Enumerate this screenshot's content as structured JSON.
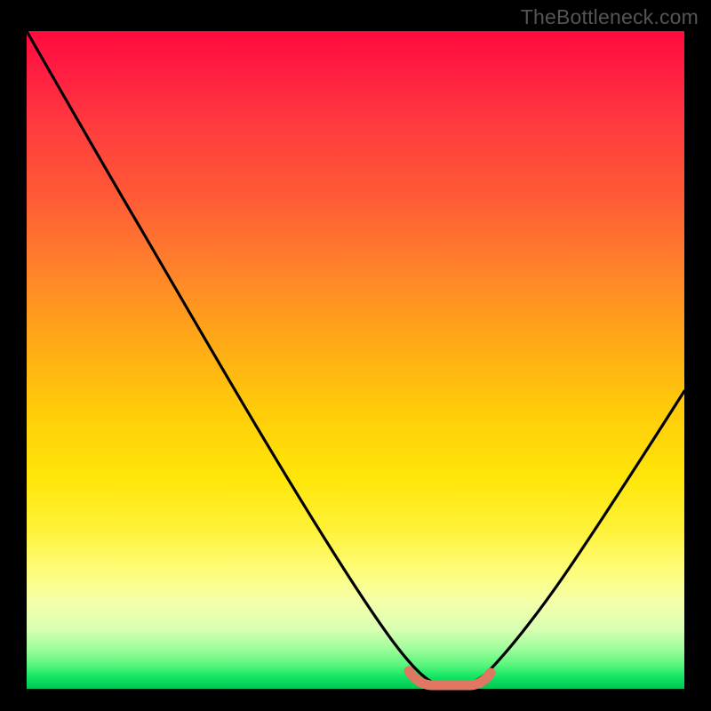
{
  "watermark": "TheBottleneck.com",
  "colors": {
    "stroke": "#000000",
    "marker": "#e07762"
  },
  "chart_data": {
    "type": "line",
    "title": "",
    "xlabel": "",
    "ylabel": "",
    "xlim": [
      0,
      100
    ],
    "ylim": [
      0,
      100
    ],
    "grid": false,
    "legend": false,
    "series": [
      {
        "name": "v-curve",
        "x": [
          0,
          5,
          10,
          15,
          20,
          25,
          30,
          35,
          40,
          45,
          50,
          55,
          58,
          60,
          63,
          66,
          70,
          72,
          76,
          80,
          85,
          90,
          95,
          100
        ],
        "y": [
          100,
          92,
          84,
          76,
          68,
          60,
          52,
          43,
          35,
          26,
          18,
          10,
          5,
          2,
          0.5,
          0.5,
          3,
          7,
          14,
          22,
          32,
          42,
          52,
          60
        ]
      }
    ],
    "marker_region": {
      "x_start": 58,
      "x_end": 70,
      "y": 0.5
    }
  }
}
